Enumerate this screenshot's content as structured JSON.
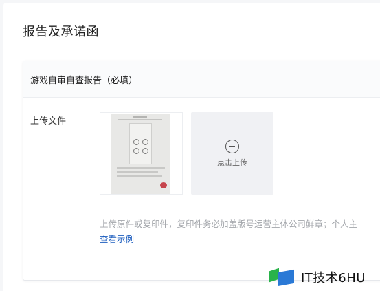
{
  "page": {
    "title": "报告及承诺函"
  },
  "card": {
    "header": "游戏自审自查报告（必填）",
    "upload_label": "上传文件",
    "upload_button": "点击上传",
    "hint": "上传原件或复印件，复印件务必加盖版号运营主体公司鲜章；个人主",
    "example_link": "查看示例"
  },
  "watermark": {
    "text": "IT技术6HU",
    "icon": "logo-icon"
  }
}
